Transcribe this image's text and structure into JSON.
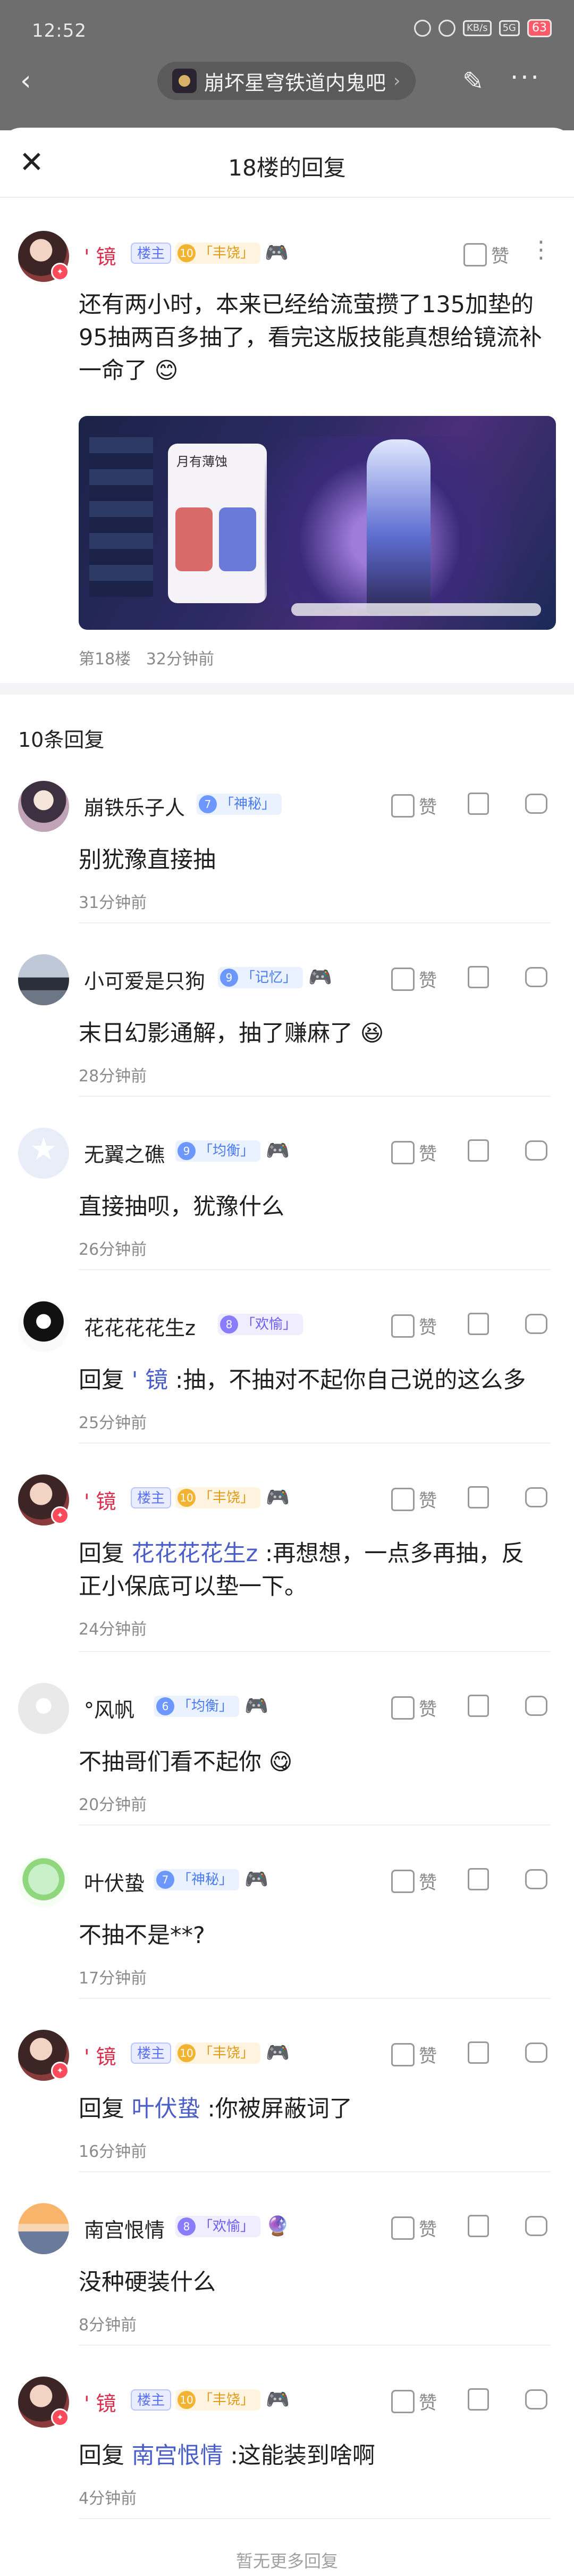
{
  "status_bar": {
    "time": "12:52",
    "battery": "63",
    "net1": "5G",
    "net2": "KB/s"
  },
  "topbar": {
    "forum_name": "崩坏星穹铁道内鬼吧",
    "chevron": "›"
  },
  "sheet": {
    "title": "18楼的回复"
  },
  "main_post": {
    "username": "' 镜",
    "owner_tag": "楼主",
    "level": "10",
    "level_title": "「丰饶」",
    "like_label": "赞",
    "text": "还有两小时，本来已经给流萤攒了135加垫的95抽两百多抽了，看完这版技能真想给镜流补一命了",
    "floor": "第18楼",
    "time": "32分钟前",
    "screenshot": {
      "panel_title": "月有薄蚀"
    }
  },
  "replies_title": "10条回复",
  "replies": [
    {
      "username": "崩铁乐子人",
      "level": "7",
      "level_title": "「神秘」",
      "body": "别犹豫直接抽",
      "time": "31分钟前"
    },
    {
      "username": "小可爱是只狗",
      "level": "9",
      "level_title": "「记忆」",
      "body": "末日幻影通解，抽了赚麻了",
      "time": "28分钟前"
    },
    {
      "username": "无翼之礁",
      "level": "9",
      "level_title": "「均衡」",
      "body": "直接抽呗，犹豫什么",
      "time": "26分钟前"
    },
    {
      "username": "花花花花生z",
      "level": "8",
      "level_title": "「欢愉」",
      "reply_prefix": "回复",
      "reply_to": "' 镜",
      "body": ":抽，不抽对不起你自己说的这么多",
      "time": "25分钟前"
    },
    {
      "username": "' 镜",
      "owner_tag": "楼主",
      "level": "10",
      "level_title": "「丰饶」",
      "reply_prefix": "回复",
      "reply_to": "花花花花生z",
      "body": ":再想想，一点多再抽，反正小保底可以垫一下。",
      "time": "24分钟前"
    },
    {
      "username": "°风帆",
      "level": "6",
      "level_title": "「均衡」",
      "body": "不抽哥们看不起你",
      "time": "20分钟前"
    },
    {
      "username": "叶伏蛰",
      "level": "7",
      "level_title": "「神秘」",
      "body": "不抽不是**?",
      "time": "17分钟前"
    },
    {
      "username": "' 镜",
      "owner_tag": "楼主",
      "level": "10",
      "level_title": "「丰饶」",
      "reply_prefix": "回复",
      "reply_to": "叶伏蛰",
      "body": ":你被屏蔽词了",
      "time": "16分钟前"
    },
    {
      "username": "南宫恨情",
      "level": "8",
      "level_title": "「欢愉」",
      "body": "没种硬装什么",
      "time": "8分钟前"
    },
    {
      "username": "' 镜",
      "owner_tag": "楼主",
      "level": "10",
      "level_title": "「丰饶」",
      "reply_prefix": "回复",
      "reply_to": "南宫恨情",
      "body": ":这能装到啥啊",
      "time": "4分钟前"
    }
  ],
  "like_label": "赞",
  "footer_text": "暂无更多回复"
}
